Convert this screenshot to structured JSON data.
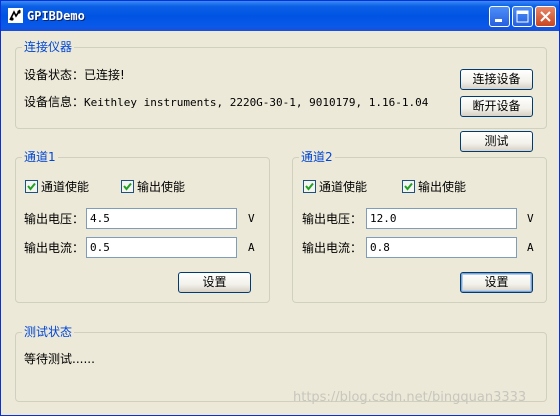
{
  "window": {
    "title": "GPIBDemo"
  },
  "connect_group": {
    "title": "连接仪器",
    "status_label": "设备状态：",
    "status_value": "已连接!",
    "info_label": "设备信息：",
    "info_value": "Keithley instruments, 2220G-30-1, 9010179, 1.16-1.04",
    "connect_button": "连接设备",
    "disconnect_button": "断开设备"
  },
  "test_button": "测试",
  "channels": [
    {
      "title": "通道1",
      "channel_enable": "通道使能",
      "output_enable": "输出使能",
      "voltage_label": "输出电压：",
      "voltage_value": "4.5",
      "voltage_unit": "V",
      "current_label": "输出电流：",
      "current_value": "0.5",
      "current_unit": "A",
      "set_button": "设置"
    },
    {
      "title": "通道2",
      "channel_enable": "通道使能",
      "output_enable": "输出使能",
      "voltage_label": "输出电压：",
      "voltage_value": "12.0",
      "voltage_unit": "V",
      "current_label": "输出电流：",
      "current_value": "0.8",
      "current_unit": "A",
      "set_button": "设置"
    }
  ],
  "status_group": {
    "title": "测试状态",
    "message": "等待测试......"
  },
  "watermark": "https://blog.csdn.net/bingquan3333",
  "icons": {
    "app": "instrument-app-icon",
    "minimize": "minimize-icon",
    "maximize": "maximize-icon",
    "close": "close-icon",
    "check": "checkmark-icon"
  },
  "colors": {
    "titlebar": "#0054e3",
    "dialog_bg": "#ece9d8",
    "group_title": "#0046d5"
  }
}
